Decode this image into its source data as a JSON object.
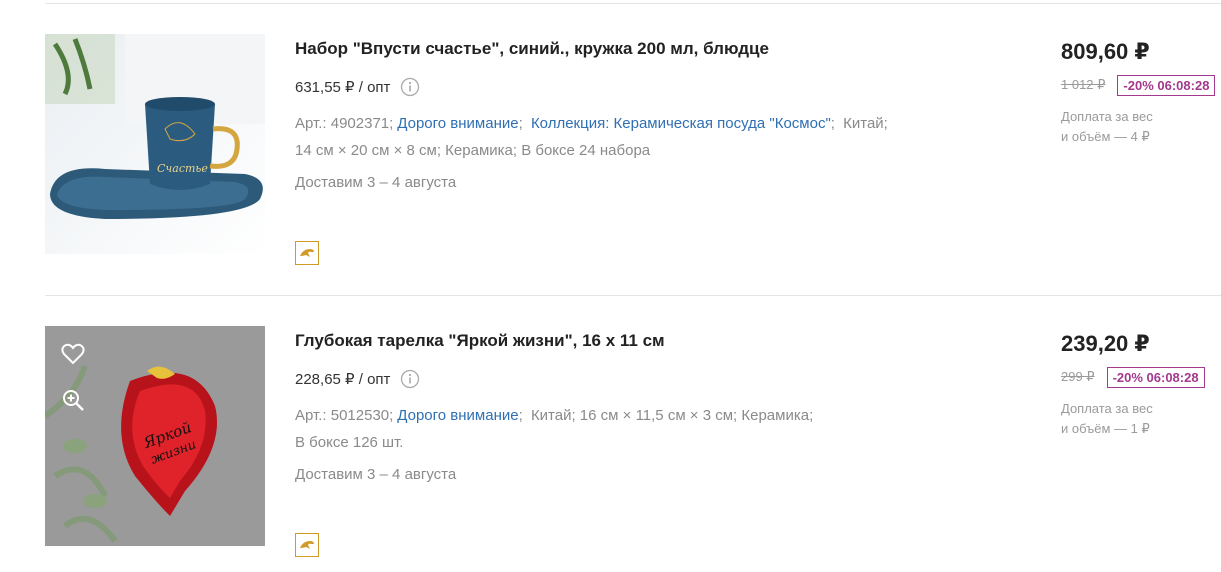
{
  "products": [
    {
      "title": "Набор \"Впусти счастье\", синий., кружка 200 мл, блюдце",
      "opt_price": "631,55 ₽ / опт",
      "art": "Арт.: 4902371;",
      "link_gift": "Дорого внимание",
      "link_collection": "Коллекция: Керамическая посуда \"Космос\"",
      "attrs_line1_tail": "Китай;",
      "attrs_line2": "14 см × 20 см × 8 см; Керамика; В боксе 24 набора",
      "delivery": "Доставим 3 – 4 августа",
      "price": "809,60 ₽",
      "old_price": "1 012 ₽",
      "discount": "-20% 06:08:28",
      "surcharge_line1": "Доплата за вес",
      "surcharge_line2": "и объём — 4 ₽",
      "image": "blue mug with saucer"
    },
    {
      "title": "Глубокая тарелка \"Яркой жизни\", 16 х 11 см",
      "opt_price": "228,65 ₽ / опт",
      "art": "Арт.: 5012530;",
      "link_gift": "Дорого внимание",
      "attrs_line1_tail": "Китай; 16 см × 11,5 см × 3 см; Керамика;",
      "attrs_line2": "В боксе 126 шт.",
      "delivery": "Доставим 3 – 4 августа",
      "price": "239,20 ₽",
      "old_price": "299 ₽",
      "discount": "-20% 06:08:28",
      "surcharge_line1": "Доплата за вес",
      "surcharge_line2": "и объём — 1 ₽",
      "image": "red strawberry-shaped plate"
    }
  ],
  "icons": {
    "info": "info-icon",
    "promo": "dolphin-promo-icon",
    "favorite": "heart-icon",
    "zoom": "zoom-in-icon"
  },
  "colors": {
    "link": "#2f6fb3",
    "discount": "#a3388d",
    "promo_border": "#d19a28"
  }
}
